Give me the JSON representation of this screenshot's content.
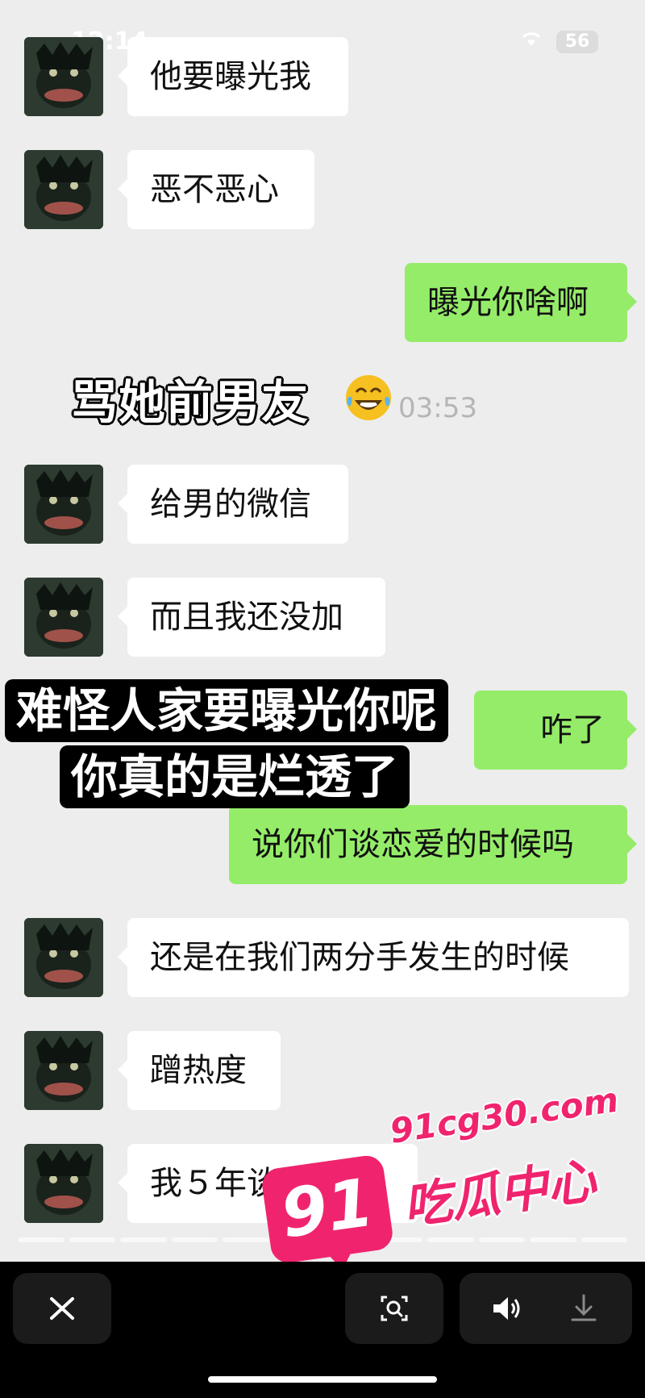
{
  "status_bar": {
    "time": "12:14",
    "battery": "56"
  },
  "messages": [
    {
      "side": "left",
      "text": "他要曝光我"
    },
    {
      "side": "left",
      "text": "恶不恶心"
    },
    {
      "side": "right",
      "text": "曝光你啥啊"
    },
    {
      "side": "left",
      "text": "给男的微信"
    },
    {
      "side": "left",
      "text": "而且我还没加"
    },
    {
      "side": "right",
      "text": "咋了"
    },
    {
      "side": "right",
      "text": "说你们谈恋爱的时候吗"
    },
    {
      "side": "left",
      "text": "还是在我们两分手发生的时候"
    },
    {
      "side": "left",
      "text": "蹭热度"
    },
    {
      "side": "left",
      "text": "我５年谈了个"
    }
  ],
  "timestamp": "03:53",
  "captions": {
    "first": "骂她前男友",
    "second_line1": "难怪人家要曝光你呢",
    "second_line2": "你真的是烂透了"
  },
  "watermark": {
    "badge": "91",
    "url": "91cg30.com",
    "name": "吃瓜中心",
    "brand_color": "#f0246e"
  },
  "controls": {
    "close_icon": "close-icon",
    "scan_icon": "scan-icon",
    "volume_icon": "volume-icon",
    "download_icon": "download-icon"
  },
  "colors": {
    "background": "#ededed",
    "sent_bubble": "#95ec69",
    "received_bubble": "#ffffff"
  }
}
